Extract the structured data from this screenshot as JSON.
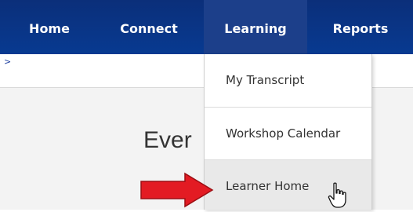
{
  "nav": {
    "items": [
      {
        "label": "Home"
      },
      {
        "label": "Connect"
      },
      {
        "label": "Learning"
      },
      {
        "label": "Reports"
      }
    ]
  },
  "breadcrumb": {
    "separator": ">"
  },
  "main": {
    "heading": "Ever"
  },
  "dropdown": {
    "items": [
      {
        "label": "My Transcript"
      },
      {
        "label": "Workshop Calendar"
      },
      {
        "label": "Learner Home"
      }
    ]
  },
  "colors": {
    "nav_bg": "#0a3585",
    "nav_active": "#1c3f8a",
    "callout_arrow": "#e31b23",
    "hover_bg": "#e9e9e9"
  },
  "icons": {
    "callout": "right-arrow-icon",
    "cursor": "hand-pointer-icon"
  }
}
